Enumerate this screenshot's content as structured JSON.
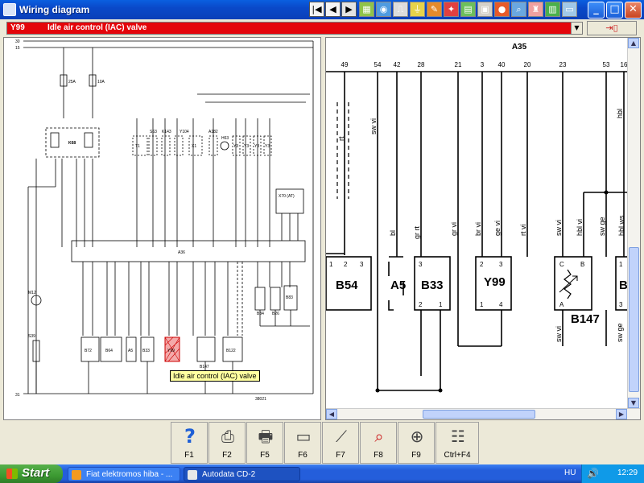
{
  "window": {
    "title": "Wiring diagram",
    "nav_buttons": [
      "first",
      "previous",
      "next",
      "last"
    ],
    "toolbar_icons": [
      "component-icon",
      "fuse-icon",
      "relay-icon",
      "ground-icon",
      "connector-icon",
      "wire-icon",
      "splice-icon",
      "sensor-icon",
      "print-icon",
      "zoom-icon",
      "reset-icon",
      "location-icon"
    ],
    "controls": {
      "minimize": "_",
      "maximize": "□",
      "close": "✕"
    }
  },
  "selector": {
    "code": "Y99",
    "description": "Idle air control (IAC) valve",
    "dropdown_arrow": "▼",
    "colors": {
      "background": "#e4050a",
      "text": "#ffffff"
    }
  },
  "left_diagram": {
    "rails": {
      "top1": "30",
      "top2": "15",
      "bottom": "31"
    },
    "fuses": [
      "25A",
      "10A"
    ],
    "relay": "K68",
    "top_components": [
      "T1",
      "S63",
      "K143",
      "Y104",
      "X1",
      "A182",
      "H63",
      "Y3",
      "Y3",
      "Y3",
      "Y3"
    ],
    "connector": "X70 (AT)",
    "ecu": "A36",
    "motor": "M12",
    "resistor": "S39",
    "bottom_components": [
      "B72",
      "B64",
      "A5",
      "B33",
      "Y99",
      "B147",
      "B122"
    ],
    "side_components": [
      "B34",
      "B26",
      "B83"
    ],
    "ref": "38021",
    "tooltip": "Idle air control (IAC) valve"
  },
  "right_diagram": {
    "connector_label": "A35",
    "pin_numbers": [
      "49",
      "54",
      "42",
      "28",
      "21",
      "3",
      "40",
      "20",
      "23",
      "53",
      "16"
    ],
    "wire_labels": [
      "rt",
      "sw vi",
      "bl",
      "gr rt",
      "gr vi",
      "br vi",
      "ge vi",
      "rt vi",
      "sw vi",
      "hbl vi",
      "sw ge",
      "hbl ws",
      "hbl",
      "sw vi",
      "sw ge"
    ],
    "components": [
      {
        "name": "B54",
        "pins": [
          "1",
          "2",
          "3"
        ]
      },
      {
        "name": "A5",
        "pins": []
      },
      {
        "name": "B33",
        "pins": [
          "3",
          "2",
          "1"
        ]
      },
      {
        "name": "Y99",
        "pins": [
          "2",
          "3",
          "1",
          "4"
        ]
      },
      {
        "name": "B147",
        "pins": [
          "C",
          "B",
          "A"
        ]
      },
      {
        "name": "B",
        "pins": [
          "1",
          "3"
        ]
      }
    ]
  },
  "function_keys": [
    {
      "key": "F1",
      "icon": "help-icon"
    },
    {
      "key": "F2",
      "icon": "print-preview-icon"
    },
    {
      "key": "F5",
      "icon": "printer-icon"
    },
    {
      "key": "F6",
      "icon": "component-values-icon"
    },
    {
      "key": "F7",
      "icon": "tools-icon"
    },
    {
      "key": "F8",
      "icon": "search-component-icon"
    },
    {
      "key": "F9",
      "icon": "zoom-icon"
    },
    {
      "key": "Ctrl+F4",
      "icon": "list-icon"
    }
  ],
  "taskbar": {
    "start": "Start",
    "tasks": [
      {
        "label": "Fiat elektromos hiba - ...",
        "active": false
      },
      {
        "label": "Autodata CD-2",
        "active": true
      }
    ],
    "language": "HU",
    "clock": "12:29"
  }
}
